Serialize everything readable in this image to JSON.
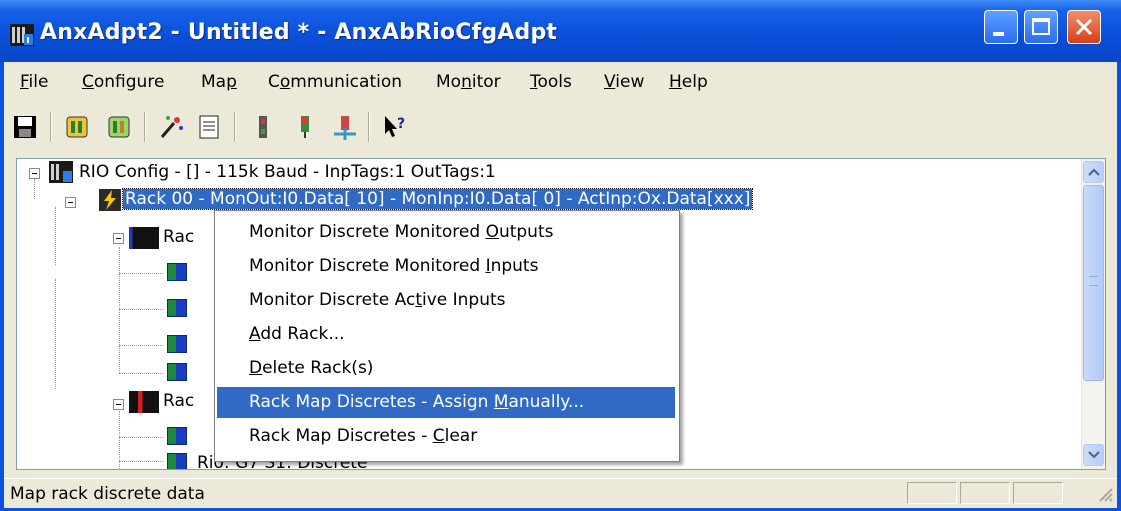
{
  "window": {
    "title": "AnxAdpt2 - Untitled * - AnxAbRioCfgAdpt"
  },
  "menubar": {
    "items": [
      {
        "label": "File",
        "key": "F"
      },
      {
        "label": "Configure",
        "key": "C"
      },
      {
        "label": "Map",
        "key": "p"
      },
      {
        "label": "Communication",
        "key": "o"
      },
      {
        "label": "Monitor",
        "key": "n"
      },
      {
        "label": "Tools",
        "key": "T"
      },
      {
        "label": "View",
        "key": "V"
      },
      {
        "label": "Help",
        "key": "H"
      }
    ]
  },
  "toolbar": {
    "icons": [
      "save-icon",
      "rack-config-icon",
      "rack-config-alt-icon",
      "magic-wand-icon",
      "document-icon",
      "monitor-signal-icon",
      "monitor-signal-red-icon",
      "connect-icon",
      "context-help-icon"
    ]
  },
  "tree": {
    "nodes": [
      {
        "label": "RIO Config - [] - 115k Baud - InpTags:1 OutTags:1"
      },
      {
        "label": "Rack 00 - MonOut:I0.Data[ 10] - MonInp:I0.Data[ 0] - ActInp:Ox.Data[xxx]"
      },
      {
        "label": "Rac"
      },
      {
        "label": "Rac"
      },
      {
        "label": "Rio: G7 S1: Discrete"
      }
    ]
  },
  "context_menu": {
    "items": [
      {
        "label": "Monitor Discrete Monitored Outputs",
        "selected": false
      },
      {
        "label": "Monitor Discrete Monitored Inputs",
        "selected": false
      },
      {
        "label": "Monitor Discrete Active Inputs",
        "selected": false
      },
      {
        "label": "Add Rack...",
        "selected": false
      },
      {
        "label": "Delete Rack(s)",
        "selected": false
      },
      {
        "label": "Rack Map Discretes - Assign Manually...",
        "selected": true
      },
      {
        "label": "Rack Map Discretes - Clear",
        "selected": false
      }
    ]
  },
  "statusbar": {
    "text": "Map rack discrete data"
  },
  "colors": {
    "title_bar": "#0a4fd9",
    "selection": "#316ac5",
    "menu_face": "#ece9d8"
  }
}
